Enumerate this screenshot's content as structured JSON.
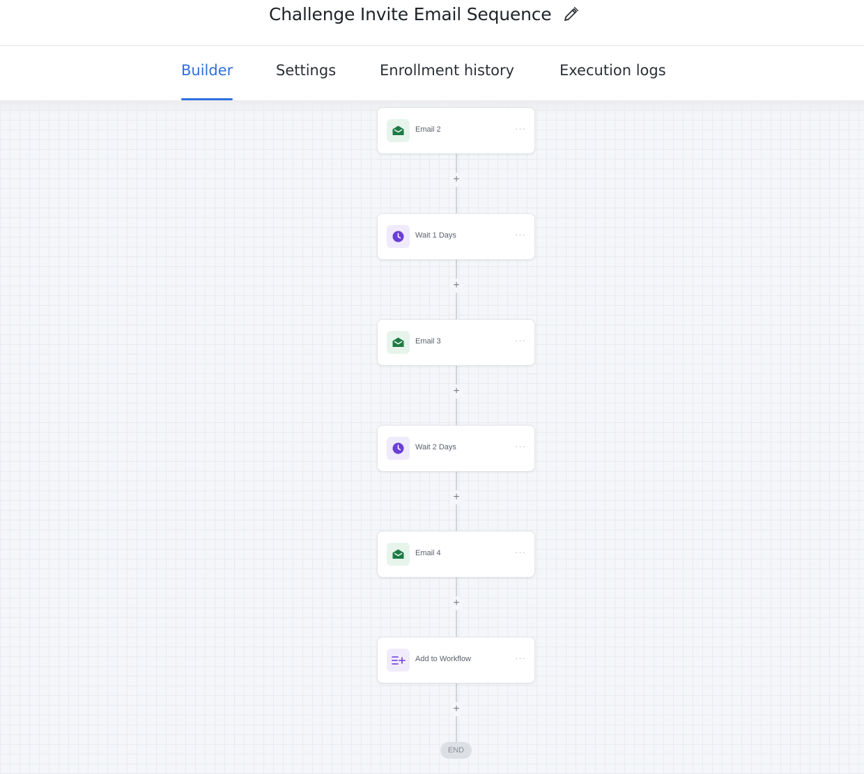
{
  "header": {
    "title": "Challenge Invite Email Sequence"
  },
  "tabs": [
    {
      "label": "Builder",
      "active": true
    },
    {
      "label": "Settings",
      "active": false
    },
    {
      "label": "Enrollment history",
      "active": false
    },
    {
      "label": "Execution logs",
      "active": false
    }
  ],
  "flow": {
    "nodes": [
      {
        "label": "Email 2",
        "icon": "email-icon",
        "kind": "email"
      },
      {
        "label": "Wait 1 Days",
        "icon": "clock-icon",
        "kind": "wait"
      },
      {
        "label": "Email 3",
        "icon": "email-icon",
        "kind": "email"
      },
      {
        "label": "Wait 2 Days",
        "icon": "clock-icon",
        "kind": "wait"
      },
      {
        "label": "Email 4",
        "icon": "email-icon",
        "kind": "email"
      },
      {
        "label": "Add to Workflow",
        "icon": "add-to-workflow-icon",
        "kind": "workflow"
      }
    ],
    "node_menu_glyph": "···",
    "add_glyph": "+",
    "end_label": "END"
  },
  "colors": {
    "accent": "#2f6fdf",
    "email_icon": "#1e7a45",
    "wait_icon": "#6a3fd6",
    "workflow_icon": "#7b4fe0"
  }
}
